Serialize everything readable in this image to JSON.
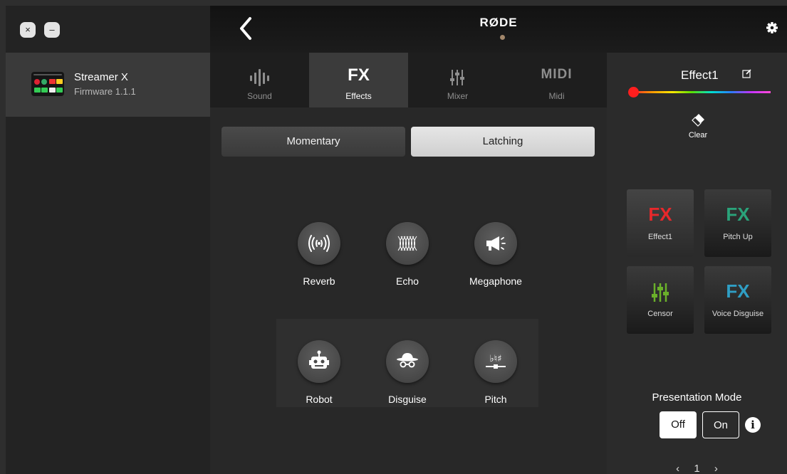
{
  "window": {
    "close_glyph": "×",
    "minimize_glyph": "–"
  },
  "sidebar": {
    "device": {
      "name": "Streamer X",
      "firmware": "Firmware 1.1.1",
      "icon": "device-thumbnail"
    }
  },
  "header": {
    "back_icon": "chevron-left-icon",
    "brand": "RØDE",
    "settings_icon": "gear-icon"
  },
  "tabs": [
    {
      "label": "Sound",
      "icon": "waveform-icon",
      "active": false
    },
    {
      "label": "Effects",
      "icon_text": "FX",
      "active": true
    },
    {
      "label": "Mixer",
      "icon": "faders-icon",
      "active": false
    },
    {
      "label": "Midi",
      "icon_text": "MIDI",
      "active": false
    }
  ],
  "mode": {
    "momentary": "Momentary",
    "latching": "Latching",
    "selected": "Latching"
  },
  "effects": [
    {
      "label": "Reverb",
      "icon": "reverb-icon"
    },
    {
      "label": "Echo",
      "icon": "echo-icon"
    },
    {
      "label": "Megaphone",
      "icon": "megaphone-icon"
    },
    {
      "label": "Robot",
      "icon": "robot-icon"
    },
    {
      "label": "Disguise",
      "icon": "disguise-icon"
    },
    {
      "label": "Pitch",
      "icon": "pitch-icon"
    }
  ],
  "right_panel": {
    "effect_name": "Effect1",
    "edit_icon": "edit-icon",
    "clear_label": "Clear",
    "clear_icon": "eraser-icon",
    "accent_color": "#ff1e1e",
    "tiles": [
      {
        "fx": "FX",
        "label": "Effect1",
        "color": "#e8282b",
        "selected": true
      },
      {
        "fx": "FX",
        "label": "Pitch Up",
        "color": "#2aa37a",
        "selected": false
      },
      {
        "fx": "",
        "label": "Censor",
        "color": "#6ab02a",
        "icon": "faders-icon",
        "selected": false
      },
      {
        "fx": "FX",
        "label": "Voice Disguise",
        "color": "#2f9ec4",
        "selected": false
      }
    ],
    "presentation_mode": {
      "title": "Presentation Mode",
      "off": "Off",
      "on": "On",
      "selected": "Off",
      "info_glyph": "i"
    },
    "pager": {
      "prev": "‹",
      "page": "1",
      "next": "›"
    }
  }
}
